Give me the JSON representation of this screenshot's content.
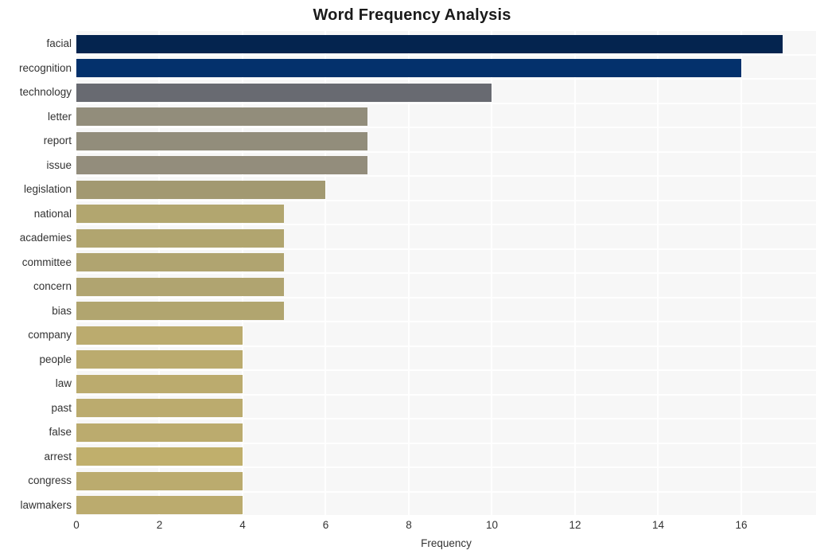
{
  "chart_data": {
    "type": "bar",
    "orientation": "horizontal",
    "title": "Word Frequency Analysis",
    "xlabel": "Frequency",
    "ylabel": "",
    "xlim": [
      0,
      17.8
    ],
    "ylim": [
      0,
      20
    ],
    "grid": true,
    "legend": null,
    "xticks": [
      0,
      2,
      4,
      6,
      8,
      10,
      12,
      14,
      16
    ],
    "categories": [
      "facial",
      "recognition",
      "technology",
      "letter",
      "report",
      "issue",
      "legislation",
      "national",
      "academies",
      "committee",
      "concern",
      "bias",
      "company",
      "people",
      "law",
      "past",
      "false",
      "arrest",
      "congress",
      "lawmakers"
    ],
    "values": [
      17,
      16,
      10,
      7,
      7,
      7,
      6,
      5,
      5,
      5,
      5,
      5,
      4,
      4,
      4,
      4,
      4,
      4,
      4,
      4
    ],
    "bar_colors": [
      "#04244f",
      "#04316c",
      "#686a71",
      "#928d7b",
      "#928d7b",
      "#938d7c",
      "#a29971",
      "#b2a66f",
      "#b1a56f",
      "#b0a470",
      "#b0a470",
      "#b1a56f",
      "#bbab6e",
      "#bbab6e",
      "#bbab6e",
      "#bbab6e",
      "#bbab6e",
      "#c0af6c",
      "#bbab6e",
      "#bbab6e"
    ]
  },
  "style": {
    "plot_background": "#f7f7f7",
    "figure_background": "#ffffff",
    "gridline_color": "#ffffff",
    "text_color": "#333333",
    "title_color": "#1a1a1a"
  }
}
